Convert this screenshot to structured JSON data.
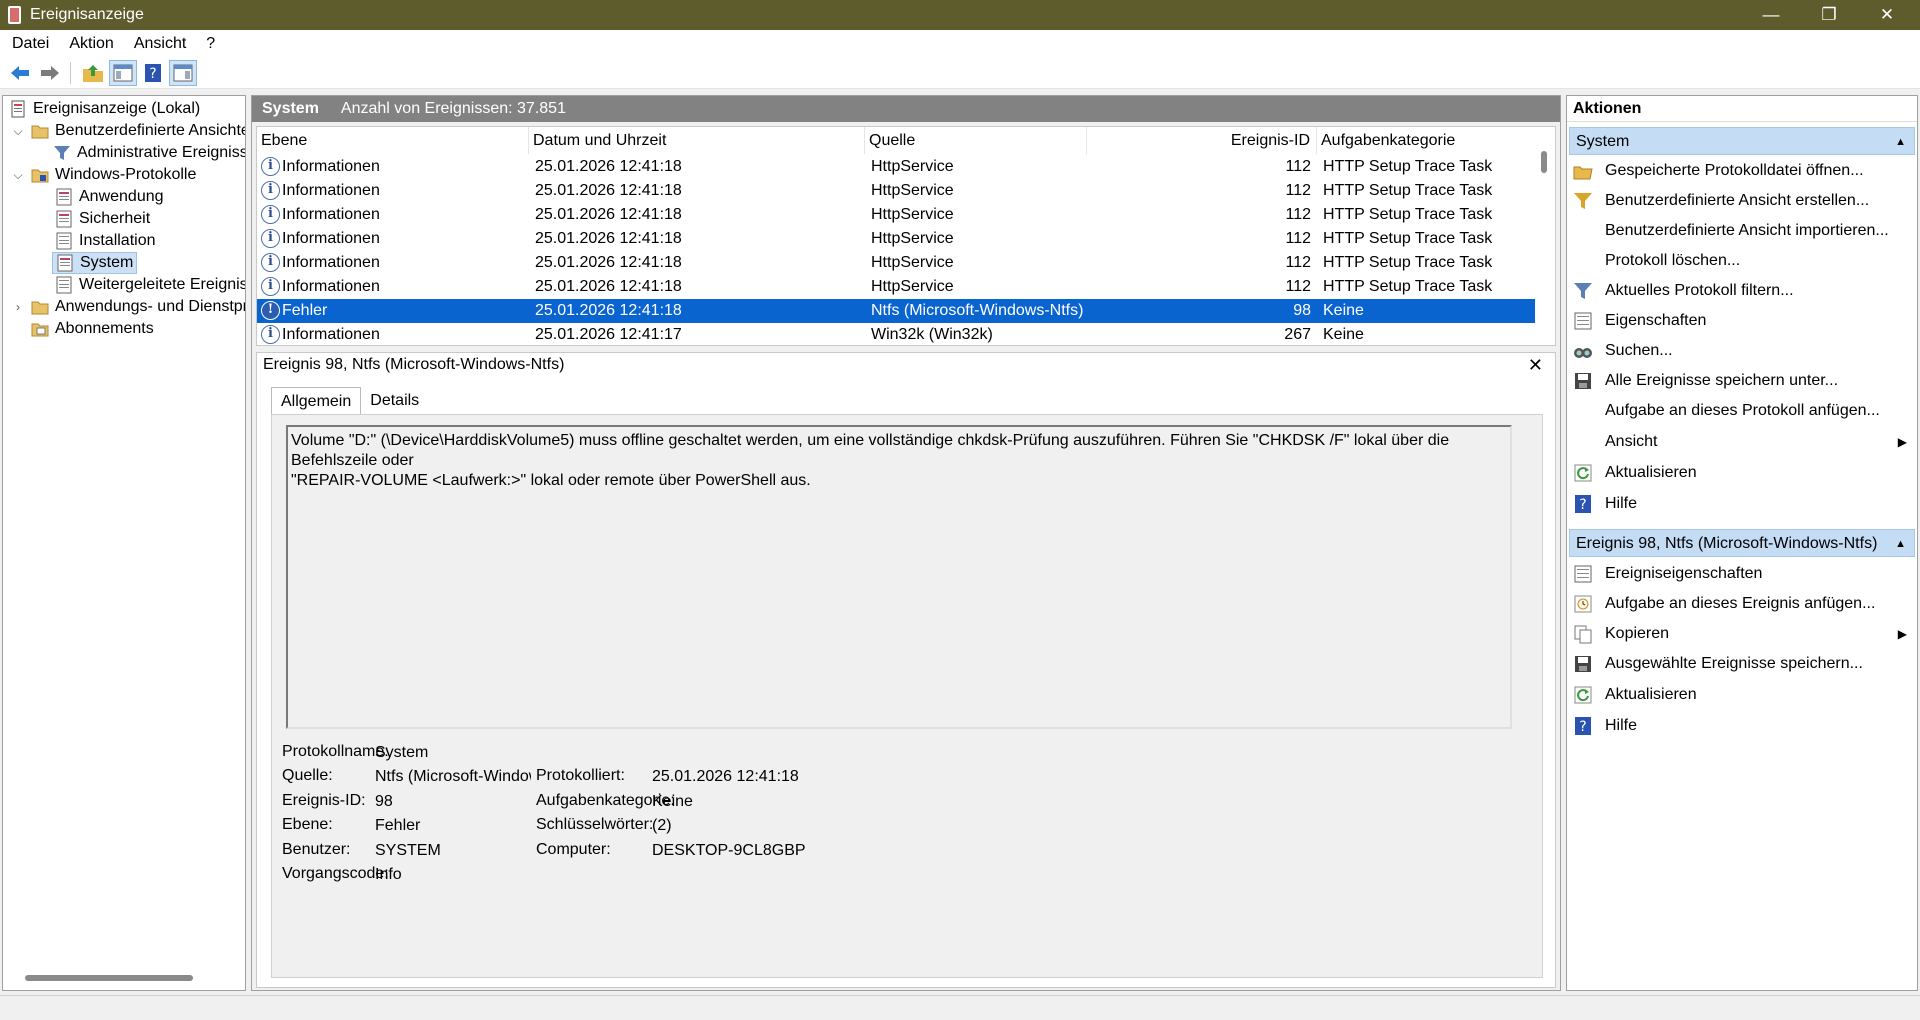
{
  "window": {
    "title": "Ereignisanzeige",
    "minimize": "—",
    "restore": "❐",
    "close": "✕"
  },
  "menu": [
    "Datei",
    "Aktion",
    "Ansicht",
    "?"
  ],
  "toolbar": {
    "buttons": [
      "back-arrow-icon",
      "forward-arrow-icon",
      "folder-up-icon",
      "show-hide-tree-icon",
      "help-icon",
      "show-hide-action-icon"
    ]
  },
  "tree": {
    "root": "Ereignisanzeige (Lokal)",
    "custom_views": "Benutzerdefinierte Ansichten",
    "admin_events": "Administrative Ereignisse",
    "windows_logs": "Windows-Protokolle",
    "application": "Anwendung",
    "security": "Sicherheit",
    "setup": "Installation",
    "system": "System",
    "forwarded": "Weitergeleitete Ereignisse",
    "apps_services": "Anwendungs- und Dienstprotokolle",
    "subscriptions": "Abonnements"
  },
  "log": {
    "name": "System",
    "count_label": "Anzahl von Ereignissen: 37.851"
  },
  "columns": {
    "level": "Ebene",
    "datetime": "Datum und Uhrzeit",
    "source": "Quelle",
    "event_id": "Ereignis-ID",
    "task": "Aufgabenkategorie"
  },
  "rows": [
    {
      "level": "Informationen",
      "datetime": "25.01.2026 12:41:18",
      "source": "HttpService",
      "event_id": "112",
      "task": "HTTP Setup Trace Task"
    },
    {
      "level": "Informationen",
      "datetime": "25.01.2026 12:41:18",
      "source": "HttpService",
      "event_id": "112",
      "task": "HTTP Setup Trace Task"
    },
    {
      "level": "Informationen",
      "datetime": "25.01.2026 12:41:18",
      "source": "HttpService",
      "event_id": "112",
      "task": "HTTP Setup Trace Task"
    },
    {
      "level": "Informationen",
      "datetime": "25.01.2026 12:41:18",
      "source": "HttpService",
      "event_id": "112",
      "task": "HTTP Setup Trace Task"
    },
    {
      "level": "Informationen",
      "datetime": "25.01.2026 12:41:18",
      "source": "HttpService",
      "event_id": "112",
      "task": "HTTP Setup Trace Task"
    },
    {
      "level": "Informationen",
      "datetime": "25.01.2026 12:41:18",
      "source": "HttpService",
      "event_id": "112",
      "task": "HTTP Setup Trace Task"
    },
    {
      "level": "Fehler",
      "datetime": "25.01.2026 12:41:18",
      "source": "Ntfs (Microsoft-Windows-Ntfs)",
      "event_id": "98",
      "task": "Keine"
    },
    {
      "level": "Informationen",
      "datetime": "25.01.2026 12:41:17",
      "source": "Win32k (Win32k)",
      "event_id": "267",
      "task": "Keine"
    }
  ],
  "detail": {
    "title": "Ereignis 98, Ntfs (Microsoft-Windows-Ntfs)",
    "close": "✕",
    "tabs": [
      "Allgemein",
      "Details"
    ],
    "message_line1": "Volume \"D:\" (\\Device\\HarddiskVolume5) muss offline geschaltet werden, um eine vollständige chkdsk-Prüfung auszuführen. Führen Sie \"CHKDSK /F\" lokal über die Befehlszeile oder",
    "message_line2": "\"REPAIR-VOLUME <Laufwerk:>\" lokal oder remote über PowerShell aus.",
    "labels": {
      "log_name": "Protokollname:",
      "source": "Quelle:",
      "event_id": "Ereignis-ID:",
      "level": "Ebene:",
      "user": "Benutzer:",
      "opcode": "Vorgangscode:",
      "logged": "Protokolliert:",
      "task": "Aufgabenkategorie:",
      "keywords": "Schlüsselwörter:",
      "computer": "Computer:"
    },
    "values": {
      "log_name": "System",
      "source": "Ntfs (Microsoft-Windows-Nt",
      "event_id": "98",
      "level": "Fehler",
      "user": "SYSTEM",
      "opcode": "Info",
      "logged": "25.01.2026 12:41:18",
      "task": "Keine",
      "keywords": "(2)",
      "computer": "DESKTOP-9CL8GBP"
    }
  },
  "actions": {
    "header": "Aktionen",
    "section1": "System",
    "items1": [
      "Gespeicherte Protokolldatei öffnen...",
      "Benutzerdefinierte Ansicht erstellen...",
      "Benutzerdefinierte Ansicht importieren...",
      "Protokoll löschen...",
      "Aktuelles Protokoll filtern...",
      "Eigenschaften",
      "Suchen...",
      "Alle Ereignisse speichern unter...",
      "Aufgabe an dieses Protokoll anfügen...",
      "Ansicht",
      "Aktualisieren",
      "Hilfe"
    ],
    "section2": "Ereignis 98, Ntfs (Microsoft-Windows-Ntfs)",
    "items2": [
      "Ereigniseigenschaften",
      "Aufgabe an dieses Ereignis anfügen...",
      "Kopieren",
      "Ausgewählte Ereignisse speichern...",
      "Aktualisieren",
      "Hilfe"
    ]
  }
}
